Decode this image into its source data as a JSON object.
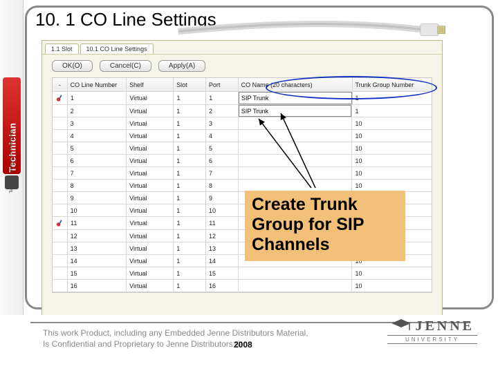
{
  "title": "10. 1 CO Line Settings",
  "sidebar": {
    "brand": "Technician",
    "tagline": "Technical Solutions for Technicians"
  },
  "app": {
    "tabs": [
      "1.1 Slot",
      "10.1 CO Line Settings"
    ],
    "buttons": {
      "ok": "OK(O)",
      "cancel": "Cancel(C)",
      "apply": "Apply(A)"
    },
    "columns": {
      "badge": "-",
      "number": "CO Line Number",
      "shelf": "Shelf",
      "slot": "Slot",
      "port": "Port",
      "name": "CO Name (20 characters)",
      "tg": "Trunk Group Number"
    },
    "rows": [
      {
        "badge": true,
        "num": "1",
        "shelf": "Virtual",
        "slot": "1",
        "port": "1",
        "name": "SIP Trunk",
        "tg": "1"
      },
      {
        "badge": false,
        "num": "2",
        "shelf": "Virtual",
        "slot": "1",
        "port": "2",
        "name": "SIP Trunk",
        "tg": "1"
      },
      {
        "badge": false,
        "num": "3",
        "shelf": "Virtual",
        "slot": "1",
        "port": "3",
        "name": "",
        "tg": "10"
      },
      {
        "badge": false,
        "num": "4",
        "shelf": "Virtual",
        "slot": "1",
        "port": "4",
        "name": "",
        "tg": "10"
      },
      {
        "badge": false,
        "num": "5",
        "shelf": "Virtual",
        "slot": "1",
        "port": "5",
        "name": "",
        "tg": "10"
      },
      {
        "badge": false,
        "num": "6",
        "shelf": "Virtual",
        "slot": "1",
        "port": "6",
        "name": "",
        "tg": "10"
      },
      {
        "badge": false,
        "num": "7",
        "shelf": "Virtual",
        "slot": "1",
        "port": "7",
        "name": "",
        "tg": "10"
      },
      {
        "badge": false,
        "num": "8",
        "shelf": "Virtual",
        "slot": "1",
        "port": "8",
        "name": "",
        "tg": "10"
      },
      {
        "badge": false,
        "num": "9",
        "shelf": "Virtual",
        "slot": "1",
        "port": "9",
        "name": "",
        "tg": "10"
      },
      {
        "badge": false,
        "num": "10",
        "shelf": "Virtual",
        "slot": "1",
        "port": "10",
        "name": "",
        "tg": "10"
      },
      {
        "badge": true,
        "num": "11",
        "shelf": "Virtual",
        "slot": "1",
        "port": "11",
        "name": "",
        "tg": "10"
      },
      {
        "badge": false,
        "num": "12",
        "shelf": "Virtual",
        "slot": "1",
        "port": "12",
        "name": "",
        "tg": "10"
      },
      {
        "badge": false,
        "num": "13",
        "shelf": "Virtual",
        "slot": "1",
        "port": "13",
        "name": "",
        "tg": "10"
      },
      {
        "badge": false,
        "num": "14",
        "shelf": "Virtual",
        "slot": "1",
        "port": "14",
        "name": "",
        "tg": "10"
      },
      {
        "badge": false,
        "num": "15",
        "shelf": "Virtual",
        "slot": "1",
        "port": "15",
        "name": "",
        "tg": "10"
      },
      {
        "badge": false,
        "num": "16",
        "shelf": "Virtual",
        "slot": "1",
        "port": "16",
        "name": "",
        "tg": "10"
      }
    ]
  },
  "callout": "Create Trunk Group for SIP Channels",
  "footer": {
    "legal1": "This work Product, including any Embedded Jenne Distributors Material,",
    "legal2": "Is Confidential and Proprietary to Jenne Distributors ©",
    "year": "2008",
    "logo_name": "JENNE",
    "logo_sub": "UNIVERSITY"
  }
}
